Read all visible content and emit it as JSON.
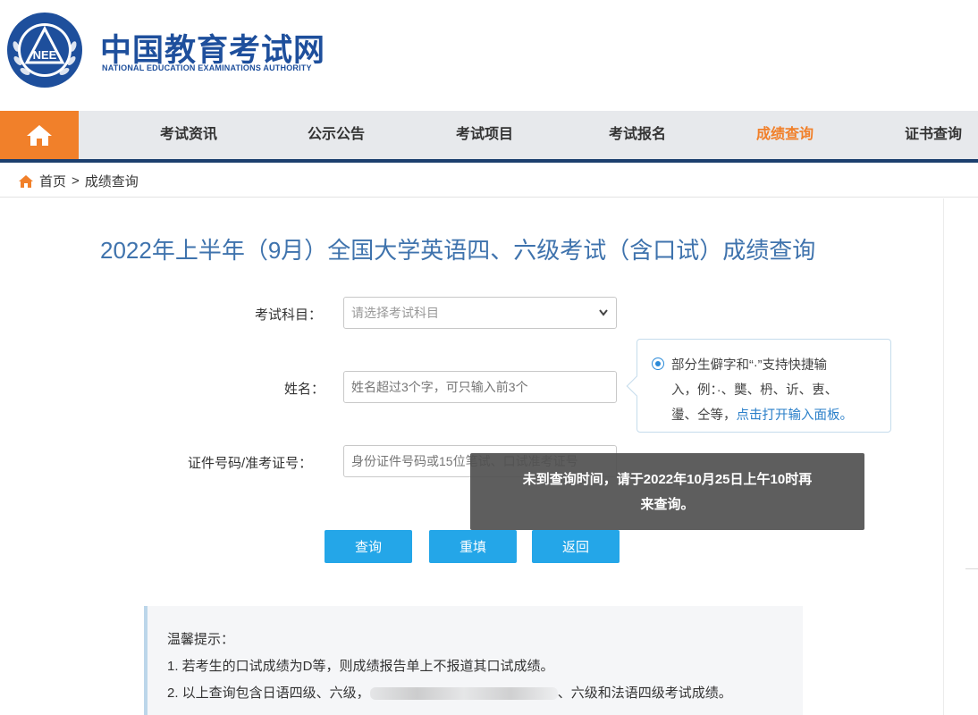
{
  "header": {
    "logo_emblem_text": "NEE",
    "site_name": "中国教育考试网",
    "site_name_en": "NATIONAL EDUCATION EXAMINATIONS AUTHORITY"
  },
  "nav": {
    "home_icon": "home-icon",
    "items": [
      {
        "label": "考试资讯"
      },
      {
        "label": "公示公告"
      },
      {
        "label": "考试项目"
      },
      {
        "label": "考试报名"
      },
      {
        "label": "成绩查询",
        "active": true
      },
      {
        "label": "证书查询"
      }
    ],
    "colors": {
      "active": "#f1802a",
      "home_bg": "#f1802a",
      "bar": "#e7e9ec",
      "underline": "#1c3f6e"
    }
  },
  "breadcrumb": {
    "home": "首页",
    "separator": ">",
    "current": "成绩查询"
  },
  "page": {
    "title": "2022年上半年（9月）全国大学英语四、六级考试（含口试）成绩查询"
  },
  "form": {
    "subject": {
      "label": "考试科目：",
      "placeholder": "请选择考试科目"
    },
    "name": {
      "label": "姓名：",
      "placeholder": "姓名超过3个字，可只输入前3个"
    },
    "id_number": {
      "label": "证件号码/准考证号：",
      "placeholder": "身份证件号码或15位笔试、口试准考证号"
    }
  },
  "tip": {
    "line1": "部分生僻字和“·”支持快捷输",
    "line2": "入，例：·、龑、枬、䜣、叀、",
    "line3_text": "璗、仝等，",
    "line3_link": "点击打开输入面板。"
  },
  "toast": {
    "line1": "未到查询时间，请于2022年10月25日上午10时再",
    "line2": "来查询。"
  },
  "buttons": {
    "query": "查询",
    "reset": "重填",
    "back": "返回"
  },
  "notice": {
    "heading": "温馨提示：",
    "item1": "1. 若考生的口试成绩为D等，则成绩报告单上不报道其口试成绩。",
    "item2_start": "2. 以上查询包含日语四级、六级，",
    "item2_end": "、六级和法语四级考试成绩。"
  }
}
